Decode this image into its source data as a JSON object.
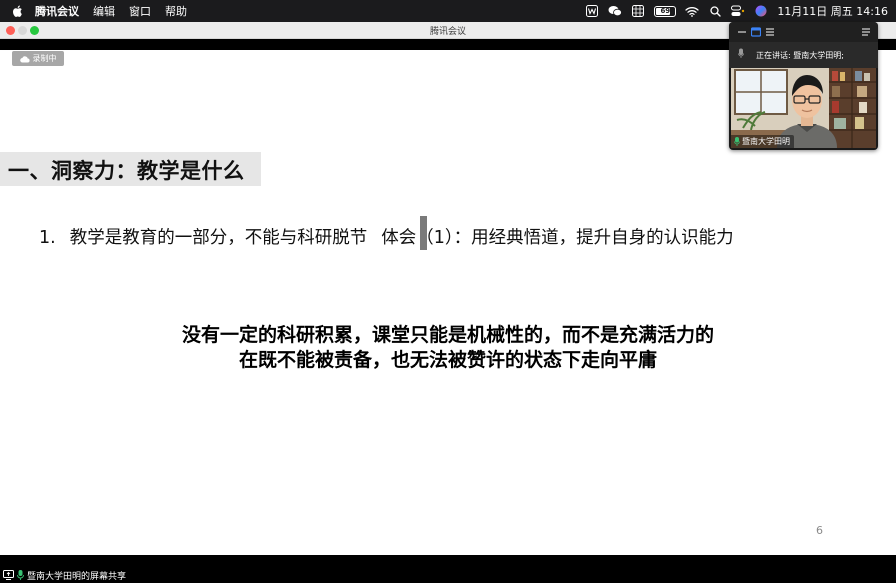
{
  "menubar": {
    "app_name": "腾讯会议",
    "items": [
      "编辑",
      "窗口",
      "帮助"
    ],
    "battery": "69",
    "clock": "11月11日 周五  14:16"
  },
  "window": {
    "title": "腾讯会议"
  },
  "recording": {
    "label": "录制中"
  },
  "slide": {
    "heading": "一、洞察力：教学是什么",
    "point_number": "1.",
    "point_text_a": "教学是教育的一部分，不能与科研脱节",
    "point_text_b": "体会（1）：用经典悟道，提升自身的认识能力",
    "quote_line1": "没有一定的科研积累，课堂只能是机械性的，而不是充满活力的",
    "quote_line2": "在既不能被责备，也无法被赞许的状态下走向平庸",
    "page_number": "6"
  },
  "video_panel": {
    "speaking_label": "正在讲话: 暨南大学田明;",
    "participant_name": "暨南大学田明"
  },
  "bottom_bar": {
    "share_label": "暨南大学田明的屏幕共享"
  },
  "colors": {
    "active_mic": "#38c172",
    "window_close": "#fe5f57",
    "window_zoom": "#28c840",
    "heading_band": "#e6e6e6",
    "panel_accent": "#3b82f6"
  }
}
